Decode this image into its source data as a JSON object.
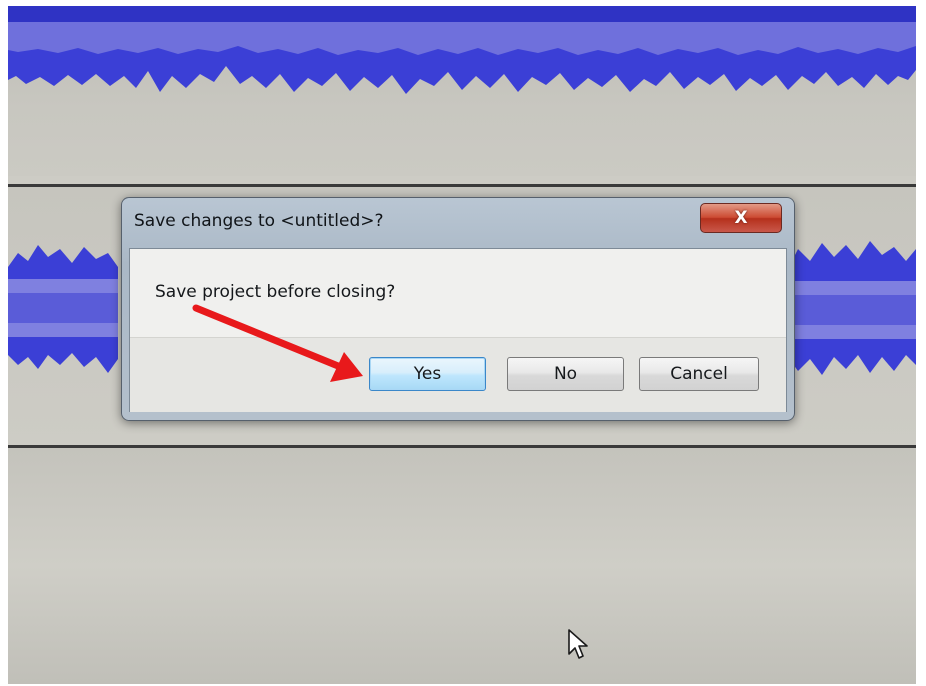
{
  "dialog": {
    "title": "Save changes to <untitled>?",
    "close_label": "X",
    "message": "Save project before closing?",
    "buttons": {
      "yes": "Yes",
      "no": "No",
      "cancel": "Cancel"
    }
  },
  "colors": {
    "waveform": "#3b3fd6",
    "waveform_light": "#7f80e0",
    "annotation_arrow": "#e8191b",
    "close_button": "#c9402c"
  },
  "icons": {
    "close": "close-icon",
    "cursor": "mouse-pointer-icon",
    "arrow": "red-arrow-annotation"
  }
}
